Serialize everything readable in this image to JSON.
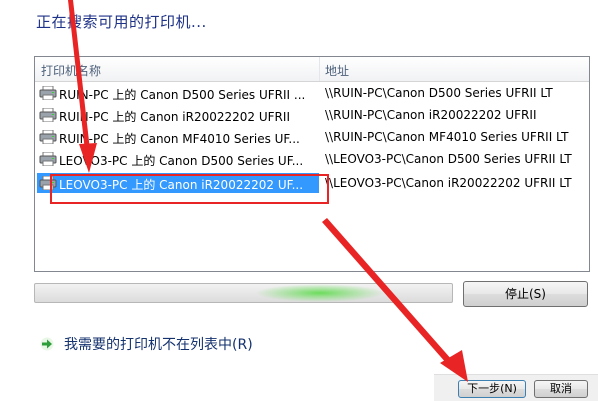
{
  "dialog": {
    "title": "正在搜索可用的打印机..."
  },
  "list": {
    "columns": {
      "name": "打印机名称",
      "address": "地址"
    },
    "rows": [
      {
        "name": "RUIN-PC 上的 Canon D500 Series UFRII ...",
        "address": "\\\\RUIN-PC\\Canon D500 Series UFRII LT",
        "selected": false
      },
      {
        "name": "RUIN-PC 上的 Canon iR20022202 UFRII",
        "address": "\\\\RUIN-PC\\Canon iR20022202 UFRII",
        "selected": false
      },
      {
        "name": "RUIN-PC 上的 Canon MF4010 Series UF...",
        "address": "\\\\RUIN-PC\\Canon MF4010 Series UFRII LT",
        "selected": false
      },
      {
        "name": "LEOVO3-PC 上的 Canon D500 Series UF...",
        "address": "\\\\LEOVO3-PC\\Canon D500 Series UFRII LT",
        "selected": false
      },
      {
        "name": "LEOVO3-PC 上的 Canon iR20022202 UF...",
        "address": "\\\\LEOVO3-PC\\Canon iR20022202 UFRII LT",
        "selected": true
      }
    ]
  },
  "progress": {
    "state": "searching"
  },
  "buttons": {
    "stop": "停止(S)",
    "next": "下一步(N)",
    "cancel": "取消"
  },
  "link": {
    "text": "我需要的打印机不在列表中(R)"
  },
  "icons": {
    "printer": "printer-icon",
    "link_arrow": "green-arrow-icon"
  },
  "colors": {
    "title": "#1e3287",
    "selection": "#3399ff",
    "annotation": "#e82424",
    "progress_glow": "#6bdc5b"
  }
}
